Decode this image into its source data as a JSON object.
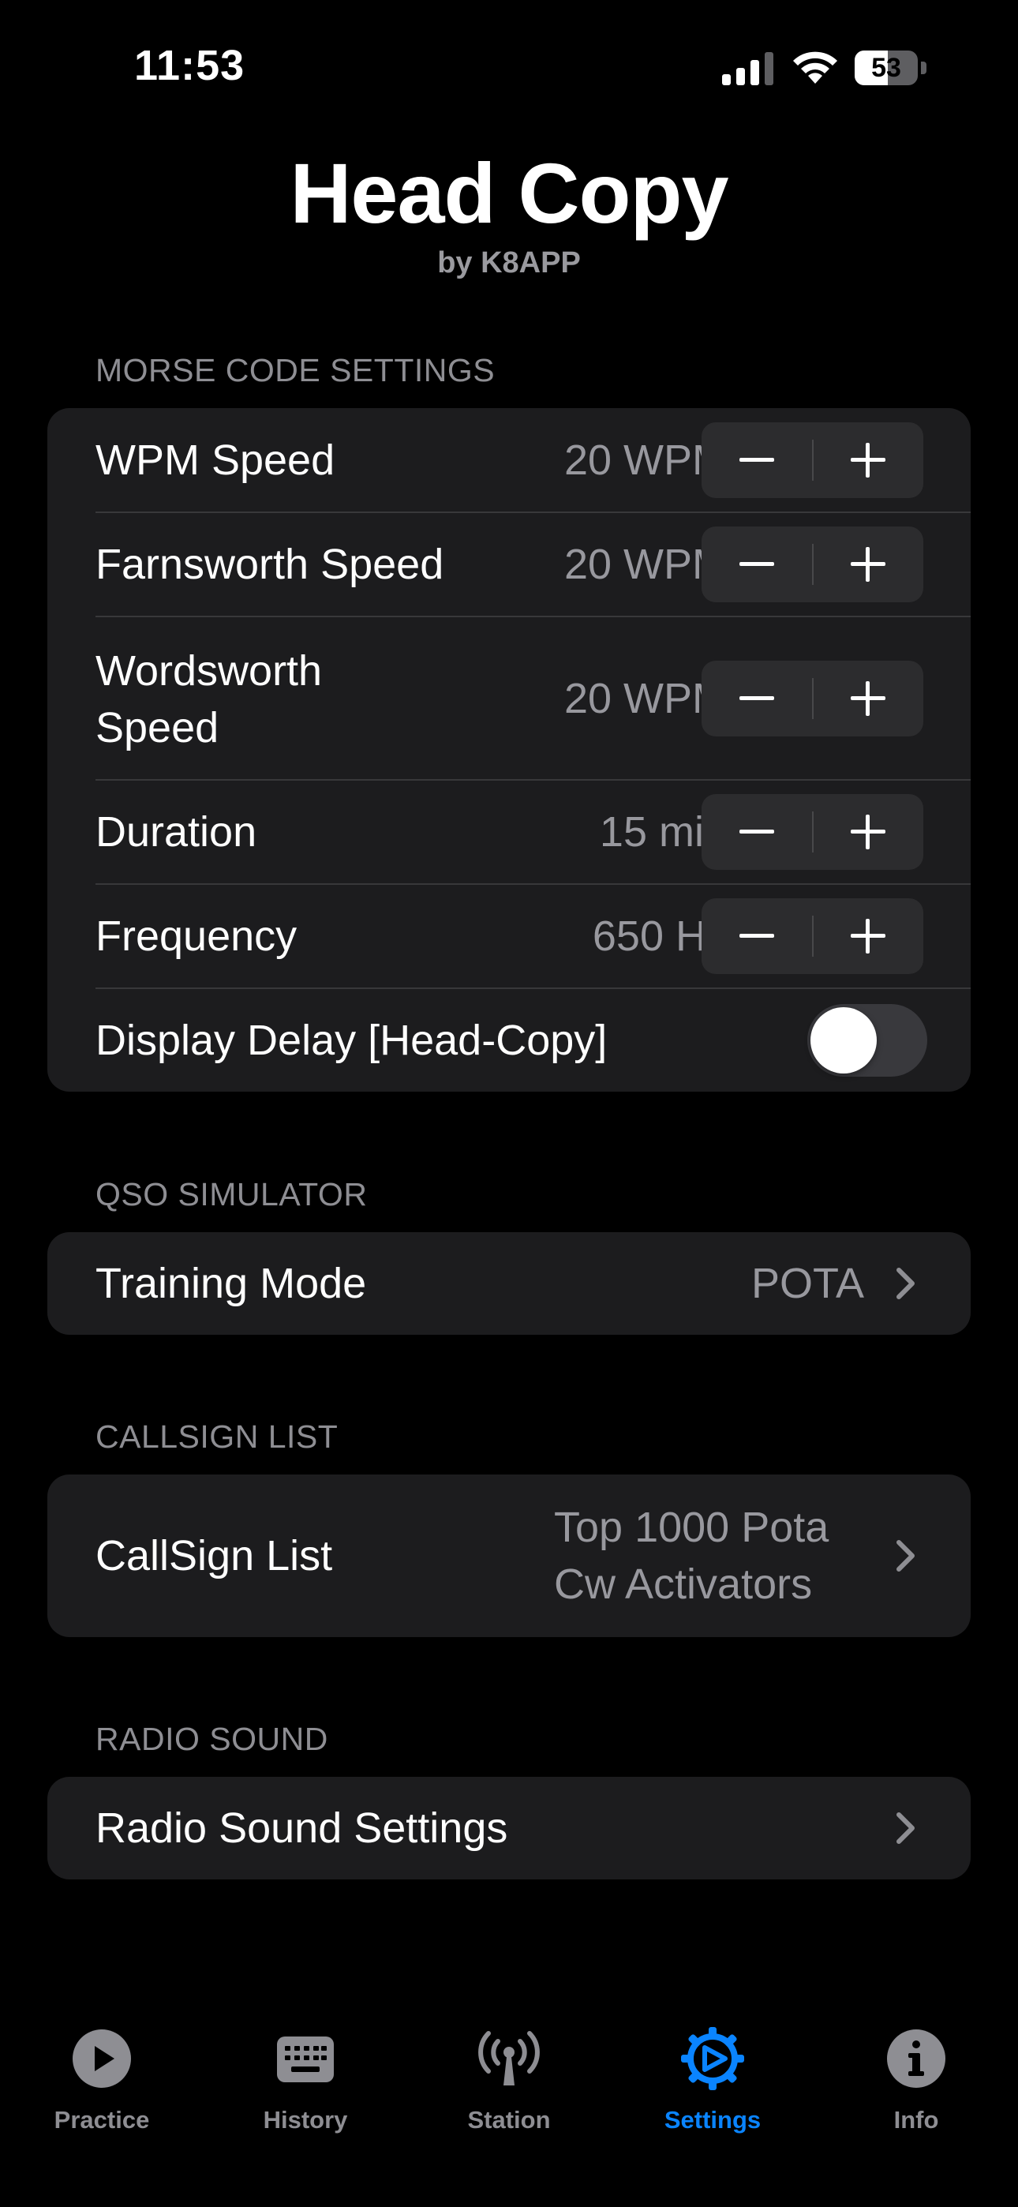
{
  "status_bar": {
    "time": "11:53",
    "battery": "53",
    "battery_level": 0.53
  },
  "header": {
    "title": "Head Copy",
    "subtitle": "by K8APP"
  },
  "morse_settings": {
    "header": "MORSE CODE SETTINGS",
    "rows": [
      {
        "label": "WPM Speed",
        "value": "20 WPM"
      },
      {
        "label": "Farnsworth Speed",
        "value": "20 WPM"
      },
      {
        "label_line1": "Wordsworth",
        "label_line2": "Speed",
        "value": "20 WPM"
      },
      {
        "label": "Duration",
        "value": "15 min"
      },
      {
        "label": "Frequency",
        "value": "650 Hz"
      },
      {
        "label": "Display Delay [Head-Copy]",
        "toggle_on": false
      }
    ]
  },
  "qso_simulator": {
    "header": "QSO SIMULATOR",
    "label": "Training Mode",
    "value": "POTA"
  },
  "callsign_list": {
    "header": "CALLSIGN LIST",
    "label": "CallSign List",
    "value_line1": "Top 1000 Pota",
    "value_line2": "Cw Activators"
  },
  "radio_sound": {
    "header": "RADIO SOUND",
    "label": "Radio Sound Settings"
  },
  "tab_bar": {
    "active": "Settings",
    "active_color": "#0a84ff",
    "items": [
      {
        "label": "Practice",
        "icon": "play-circle-icon"
      },
      {
        "label": "History",
        "icon": "keyboard-icon"
      },
      {
        "label": "Station",
        "icon": "antenna-icon"
      },
      {
        "label": "Settings",
        "icon": "gear-play-icon"
      },
      {
        "label": "Info",
        "icon": "info-circle-icon"
      }
    ]
  }
}
